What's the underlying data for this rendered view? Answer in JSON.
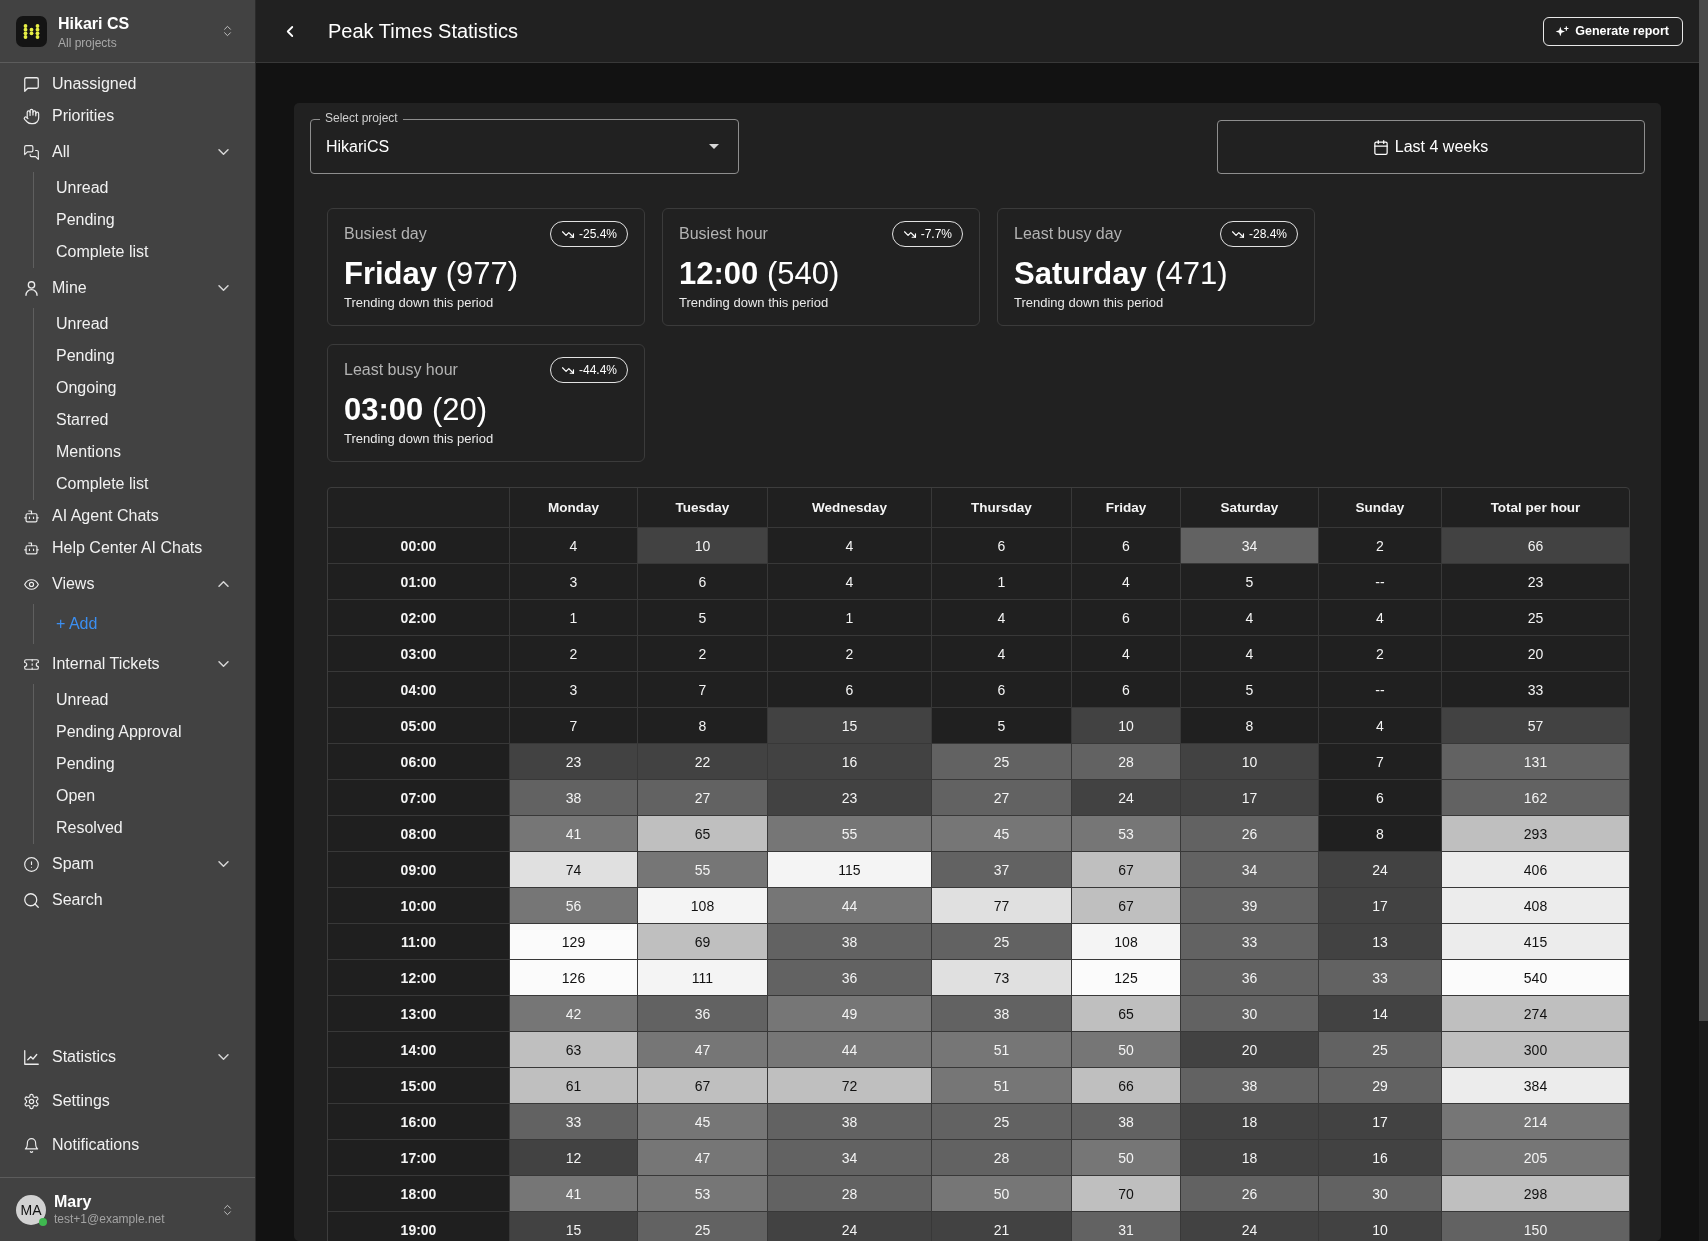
{
  "sidebar": {
    "workspace": {
      "name": "Hikari CS",
      "subtitle": "All projects"
    },
    "nav": [
      {
        "label": "Unassigned"
      },
      {
        "label": "Priorities"
      },
      {
        "label": "All",
        "chevron_up": false,
        "children": [
          {
            "label": "Unread"
          },
          {
            "label": "Pending"
          },
          {
            "label": "Complete list"
          }
        ]
      },
      {
        "label": "Mine",
        "chevron_up": false,
        "children": [
          {
            "label": "Unread"
          },
          {
            "label": "Pending"
          },
          {
            "label": "Ongoing"
          },
          {
            "label": "Starred"
          },
          {
            "label": "Mentions"
          },
          {
            "label": "Complete list"
          }
        ]
      },
      {
        "label": "AI Agent Chats"
      },
      {
        "label": "Help Center AI Chats"
      },
      {
        "label": "Views",
        "chevron_up": true,
        "action": "+ Add"
      },
      {
        "label": "Internal Tickets",
        "chevron_up": false,
        "children": [
          {
            "label": "Unread"
          },
          {
            "label": "Pending Approval"
          },
          {
            "label": "Pending"
          },
          {
            "label": "Open"
          },
          {
            "label": "Resolved"
          }
        ]
      },
      {
        "label": "Spam",
        "chevron_up": false
      },
      {
        "label": "Search"
      }
    ],
    "bottom_nav": [
      {
        "label": "Statistics",
        "chevron_up": false
      },
      {
        "label": "Settings"
      },
      {
        "label": "Notifications"
      }
    ],
    "user": {
      "initials": "MA",
      "name": "Mary",
      "email": "test+1@example.net",
      "online": true
    }
  },
  "header": {
    "title": "Peak Times Statistics",
    "generate_button": "Generate report"
  },
  "filters": {
    "project_select": {
      "label": "Select project",
      "value": "HikariCS"
    },
    "date_range": "Last 4 weeks"
  },
  "stat_cards": [
    {
      "label": "Busiest day",
      "change": "-25.4%",
      "trending_down": true,
      "value": "**Friday** (977)",
      "note": "Trending down this period"
    },
    {
      "label": "Busiest hour",
      "change": "-7.7%",
      "trending_down": true,
      "value": "**12:00** (540)",
      "note": "Trending down this period"
    },
    {
      "label": "Least busy day",
      "change": "-28.4%",
      "trending_down": true,
      "value": "**Saturday** (471)",
      "note": "Trending down this period"
    },
    {
      "label": "Least busy hour",
      "change": "-44.4%",
      "trending_down": true,
      "value": "**03:00** (20)",
      "note": "Trending down this period"
    }
  ],
  "table": {
    "columns": [
      "Monday",
      "Tuesday",
      "Wednesday",
      "Thursday",
      "Friday",
      "Saturday",
      "Sunday",
      "Total per hour"
    ],
    "rows": [
      {
        "hour": "00:00",
        "cells": [
          {
            "value": "4",
            "color": "#202020"
          },
          {
            "value": "10",
            "color": "#424242"
          },
          {
            "value": "4",
            "color": "#202020"
          },
          {
            "value": "6",
            "color": "#202020"
          },
          {
            "value": "6",
            "color": "#202020"
          },
          {
            "value": "34",
            "color": "#626262"
          },
          {
            "value": "2",
            "color": "#202020"
          },
          {
            "value": "66",
            "color": "#424242"
          }
        ]
      },
      {
        "hour": "01:00",
        "cells": [
          {
            "value": "3",
            "color": "#202020"
          },
          {
            "value": "6",
            "color": "#202020"
          },
          {
            "value": "4",
            "color": "#202020"
          },
          {
            "value": "1",
            "color": "#202020"
          },
          {
            "value": "4",
            "color": "#202020"
          },
          {
            "value": "5",
            "color": "#202020"
          },
          {
            "value": "--",
            "color": "#202020"
          },
          {
            "value": "23",
            "color": "#202020"
          }
        ]
      },
      {
        "hour": "02:00",
        "cells": [
          {
            "value": "1",
            "color": "#202020"
          },
          {
            "value": "5",
            "color": "#202020"
          },
          {
            "value": "1",
            "color": "#202020"
          },
          {
            "value": "4",
            "color": "#202020"
          },
          {
            "value": "6",
            "color": "#202020"
          },
          {
            "value": "4",
            "color": "#202020"
          },
          {
            "value": "4",
            "color": "#202020"
          },
          {
            "value": "25",
            "color": "#202020"
          }
        ]
      },
      {
        "hour": "03:00",
        "cells": [
          {
            "value": "2",
            "color": "#202020"
          },
          {
            "value": "2",
            "color": "#202020"
          },
          {
            "value": "2",
            "color": "#202020"
          },
          {
            "value": "4",
            "color": "#202020"
          },
          {
            "value": "4",
            "color": "#202020"
          },
          {
            "value": "4",
            "color": "#202020"
          },
          {
            "value": "2",
            "color": "#202020"
          },
          {
            "value": "20",
            "color": "#202020"
          }
        ]
      },
      {
        "hour": "04:00",
        "cells": [
          {
            "value": "3",
            "color": "#202020"
          },
          {
            "value": "7",
            "color": "#202020"
          },
          {
            "value": "6",
            "color": "#202020"
          },
          {
            "value": "6",
            "color": "#202020"
          },
          {
            "value": "6",
            "color": "#202020"
          },
          {
            "value": "5",
            "color": "#202020"
          },
          {
            "value": "--",
            "color": "#202020"
          },
          {
            "value": "33",
            "color": "#202020"
          }
        ]
      },
      {
        "hour": "05:00",
        "cells": [
          {
            "value": "7",
            "color": "#202020"
          },
          {
            "value": "8",
            "color": "#202020"
          },
          {
            "value": "15",
            "color": "#424242"
          },
          {
            "value": "5",
            "color": "#202020"
          },
          {
            "value": "10",
            "color": "#424242"
          },
          {
            "value": "8",
            "color": "#202020"
          },
          {
            "value": "4",
            "color": "#202020"
          },
          {
            "value": "57",
            "color": "#424242"
          }
        ]
      },
      {
        "hour": "06:00",
        "cells": [
          {
            "value": "23",
            "color": "#424242"
          },
          {
            "value": "22",
            "color": "#424242"
          },
          {
            "value": "16",
            "color": "#424242"
          },
          {
            "value": "25",
            "color": "#626262"
          },
          {
            "value": "28",
            "color": "#626262"
          },
          {
            "value": "10",
            "color": "#424242"
          },
          {
            "value": "7",
            "color": "#202020"
          },
          {
            "value": "131",
            "color": "#626262"
          }
        ]
      },
      {
        "hour": "07:00",
        "cells": [
          {
            "value": "38",
            "color": "#626262"
          },
          {
            "value": "27",
            "color": "#626262"
          },
          {
            "value": "23",
            "color": "#424242"
          },
          {
            "value": "27",
            "color": "#626262"
          },
          {
            "value": "24",
            "color": "#424242"
          },
          {
            "value": "17",
            "color": "#424242"
          },
          {
            "value": "6",
            "color": "#202020"
          },
          {
            "value": "162",
            "color": "#626262"
          }
        ]
      },
      {
        "hour": "08:00",
        "cells": [
          {
            "value": "41",
            "color": "#767676"
          },
          {
            "value": "65",
            "color": "#bfbfbf"
          },
          {
            "value": "55",
            "color": "#767676"
          },
          {
            "value": "45",
            "color": "#767676"
          },
          {
            "value": "53",
            "color": "#767676"
          },
          {
            "value": "26",
            "color": "#626262"
          },
          {
            "value": "8",
            "color": "#202020"
          },
          {
            "value": "293",
            "color": "#bfbfbf"
          }
        ]
      },
      {
        "hour": "09:00",
        "cells": [
          {
            "value": "74",
            "color": "#e0e0e0"
          },
          {
            "value": "55",
            "color": "#767676"
          },
          {
            "value": "115",
            "color": "#f4f4f4"
          },
          {
            "value": "37",
            "color": "#626262"
          },
          {
            "value": "67",
            "color": "#bfbfbf"
          },
          {
            "value": "34",
            "color": "#626262"
          },
          {
            "value": "24",
            "color": "#424242"
          },
          {
            "value": "406",
            "color": "#ececec"
          }
        ]
      },
      {
        "hour": "10:00",
        "cells": [
          {
            "value": "56",
            "color": "#767676"
          },
          {
            "value": "108",
            "color": "#f4f4f4"
          },
          {
            "value": "44",
            "color": "#767676"
          },
          {
            "value": "77",
            "color": "#e0e0e0"
          },
          {
            "value": "67",
            "color": "#bfbfbf"
          },
          {
            "value": "39",
            "color": "#626262"
          },
          {
            "value": "17",
            "color": "#424242"
          },
          {
            "value": "408",
            "color": "#ececec"
          }
        ]
      },
      {
        "hour": "11:00",
        "cells": [
          {
            "value": "129",
            "color": "#fbfbfb"
          },
          {
            "value": "69",
            "color": "#bfbfbf"
          },
          {
            "value": "38",
            "color": "#626262"
          },
          {
            "value": "25",
            "color": "#626262"
          },
          {
            "value": "108",
            "color": "#f4f4f4"
          },
          {
            "value": "33",
            "color": "#626262"
          },
          {
            "value": "13",
            "color": "#424242"
          },
          {
            "value": "415",
            "color": "#ececec"
          }
        ]
      },
      {
        "hour": "12:00",
        "cells": [
          {
            "value": "126",
            "color": "#fbfbfb"
          },
          {
            "value": "111",
            "color": "#f4f4f4"
          },
          {
            "value": "36",
            "color": "#626262"
          },
          {
            "value": "73",
            "color": "#e0e0e0"
          },
          {
            "value": "125",
            "color": "#fbfbfb"
          },
          {
            "value": "36",
            "color": "#626262"
          },
          {
            "value": "33",
            "color": "#626262"
          },
          {
            "value": "540",
            "color": "#fbfbfb"
          }
        ]
      },
      {
        "hour": "13:00",
        "cells": [
          {
            "value": "42",
            "color": "#767676"
          },
          {
            "value": "36",
            "color": "#626262"
          },
          {
            "value": "49",
            "color": "#767676"
          },
          {
            "value": "38",
            "color": "#626262"
          },
          {
            "value": "65",
            "color": "#bfbfbf"
          },
          {
            "value": "30",
            "color": "#626262"
          },
          {
            "value": "14",
            "color": "#424242"
          },
          {
            "value": "274",
            "color": "#bfbfbf"
          }
        ]
      },
      {
        "hour": "14:00",
        "cells": [
          {
            "value": "63",
            "color": "#bfbfbf"
          },
          {
            "value": "47",
            "color": "#767676"
          },
          {
            "value": "44",
            "color": "#767676"
          },
          {
            "value": "51",
            "color": "#767676"
          },
          {
            "value": "50",
            "color": "#767676"
          },
          {
            "value": "20",
            "color": "#424242"
          },
          {
            "value": "25",
            "color": "#626262"
          },
          {
            "value": "300",
            "color": "#bfbfbf"
          }
        ]
      },
      {
        "hour": "15:00",
        "cells": [
          {
            "value": "61",
            "color": "#bfbfbf"
          },
          {
            "value": "67",
            "color": "#bfbfbf"
          },
          {
            "value": "72",
            "color": "#bfbfbf"
          },
          {
            "value": "51",
            "color": "#767676"
          },
          {
            "value": "66",
            "color": "#bfbfbf"
          },
          {
            "value": "38",
            "color": "#626262"
          },
          {
            "value": "29",
            "color": "#626262"
          },
          {
            "value": "384",
            "color": "#ececec"
          }
        ]
      },
      {
        "hour": "16:00",
        "cells": [
          {
            "value": "33",
            "color": "#626262"
          },
          {
            "value": "45",
            "color": "#767676"
          },
          {
            "value": "38",
            "color": "#626262"
          },
          {
            "value": "25",
            "color": "#626262"
          },
          {
            "value": "38",
            "color": "#626262"
          },
          {
            "value": "18",
            "color": "#424242"
          },
          {
            "value": "17",
            "color": "#424242"
          },
          {
            "value": "214",
            "color": "#767676"
          }
        ]
      },
      {
        "hour": "17:00",
        "cells": [
          {
            "value": "12",
            "color": "#424242"
          },
          {
            "value": "47",
            "color": "#767676"
          },
          {
            "value": "34",
            "color": "#626262"
          },
          {
            "value": "28",
            "color": "#626262"
          },
          {
            "value": "50",
            "color": "#767676"
          },
          {
            "value": "18",
            "color": "#424242"
          },
          {
            "value": "16",
            "color": "#424242"
          },
          {
            "value": "205",
            "color": "#767676"
          }
        ]
      },
      {
        "hour": "18:00",
        "cells": [
          {
            "value": "41",
            "color": "#767676"
          },
          {
            "value": "53",
            "color": "#767676"
          },
          {
            "value": "28",
            "color": "#626262"
          },
          {
            "value": "50",
            "color": "#767676"
          },
          {
            "value": "70",
            "color": "#bfbfbf"
          },
          {
            "value": "26",
            "color": "#626262"
          },
          {
            "value": "30",
            "color": "#626262"
          },
          {
            "value": "298",
            "color": "#bfbfbf"
          }
        ]
      },
      {
        "hour": "19:00",
        "cells": [
          {
            "value": "15",
            "color": "#424242"
          },
          {
            "value": "25",
            "color": "#626262"
          },
          {
            "value": "24",
            "color": "#424242"
          },
          {
            "value": "21",
            "color": "#424242"
          },
          {
            "value": "31",
            "color": "#626262"
          },
          {
            "value": "24",
            "color": "#424242"
          },
          {
            "value": "10",
            "color": "#424242"
          },
          {
            "value": "150",
            "color": "#626262"
          }
        ]
      }
    ]
  }
}
